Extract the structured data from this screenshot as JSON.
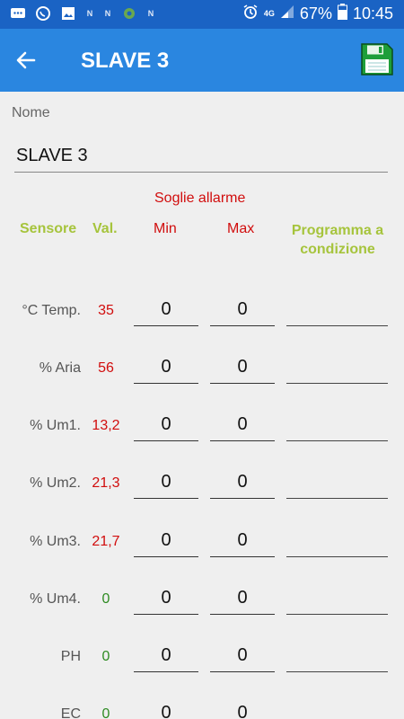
{
  "status_bar": {
    "battery": "67%",
    "time": "10:45",
    "network": "4G",
    "notif_n": "N"
  },
  "app_bar": {
    "title": "SLAVE 3",
    "back_icon": "arrow-left-icon",
    "save_icon": "floppy-disk-icon",
    "save_color": "#1e9e3a"
  },
  "form": {
    "name_label": "Nome",
    "name_value": "SLAVE 3",
    "alarm_thresholds_label": "Soglie allarme",
    "headers": {
      "sensor": "Sensore",
      "value": "Val.",
      "min": "Min",
      "max": "Max",
      "program_line1": "Programma a",
      "program_line2": "condizione"
    },
    "rows": [
      {
        "sensor": "°C Temp.",
        "value": "35",
        "value_color": "#d10d0d",
        "min": "0",
        "max": "0",
        "program": ""
      },
      {
        "sensor": "% Aria",
        "value": "56",
        "value_color": "#d10d0d",
        "min": "0",
        "max": "0",
        "program": ""
      },
      {
        "sensor": "% Um1.",
        "value": "13,2",
        "value_color": "#d10d0d",
        "min": "0",
        "max": "0",
        "program": ""
      },
      {
        "sensor": "% Um2.",
        "value": "21,3",
        "value_color": "#d10d0d",
        "min": "0",
        "max": "0",
        "program": ""
      },
      {
        "sensor": "% Um3.",
        "value": "21,7",
        "value_color": "#d10d0d",
        "min": "0",
        "max": "0",
        "program": ""
      },
      {
        "sensor": "% Um4.",
        "value": "0",
        "value_color": "#2e8b22",
        "min": "0",
        "max": "0",
        "program": ""
      },
      {
        "sensor": "PH",
        "value": "0",
        "value_color": "#2e8b22",
        "min": "0",
        "max": "0",
        "program": ""
      },
      {
        "sensor": "EC",
        "value": "0",
        "value_color": "#2e8b22",
        "min": "0",
        "max": "0",
        "program": ""
      }
    ]
  }
}
